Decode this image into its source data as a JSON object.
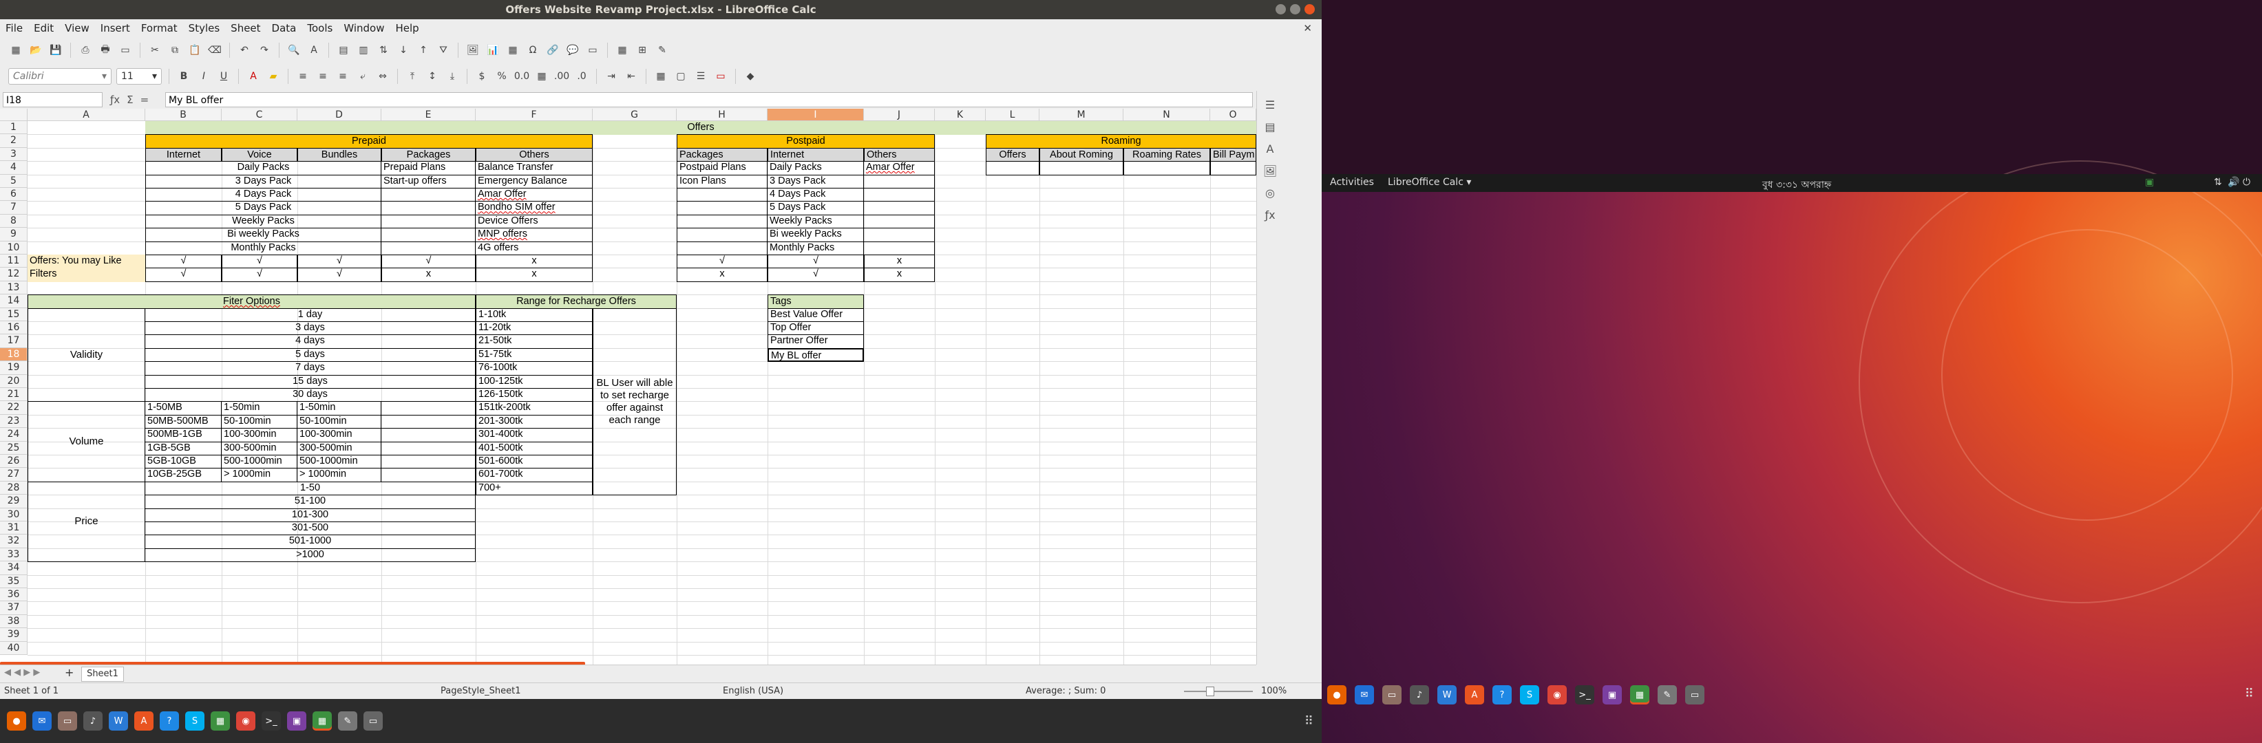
{
  "window": {
    "title": "Offers Website Revamp Project.xlsx - LibreOffice Calc"
  },
  "menu": [
    "File",
    "Edit",
    "View",
    "Insert",
    "Format",
    "Styles",
    "Sheet",
    "Data",
    "Tools",
    "Window",
    "Help"
  ],
  "font": {
    "name": "Calibri",
    "size": "11"
  },
  "formula": {
    "cell_ref": "I18",
    "content": "My BL  offer"
  },
  "columns": [
    "A",
    "B",
    "C",
    "D",
    "E",
    "F",
    "G",
    "H",
    "I",
    "J",
    "K",
    "L",
    "M",
    "N",
    "O"
  ],
  "rows": [
    "1",
    "2",
    "3",
    "4",
    "5",
    "6",
    "7",
    "8",
    "9",
    "10",
    "11",
    "12",
    "13",
    "14",
    "15",
    "16",
    "17",
    "18",
    "19",
    "20",
    "21",
    "22",
    "23",
    "24",
    "25",
    "26",
    "27",
    "28",
    "29",
    "30",
    "31",
    "32",
    "33",
    "34",
    "35",
    "36",
    "37",
    "38",
    "39",
    "40"
  ],
  "sheet": {
    "offers_title": "Offers",
    "prepaid": "Prepaid",
    "postpaid": "Postpaid",
    "roaming": "Roaming",
    "pre_headers": [
      "Internet",
      "Voice",
      "Bundles",
      "Packages",
      "Others"
    ],
    "post_headers": [
      "Packages",
      "Internet",
      "Others"
    ],
    "roam_headers": [
      "Offers",
      "About Roming",
      "Roaming Rates",
      "Bill Paym"
    ],
    "pre_packs": [
      "Daily Packs",
      "3 Days Pack",
      "4 Days Pack",
      "5 Days Pack",
      "Weekly Packs",
      "Bi weekly Packs",
      "Monthly Packs"
    ],
    "pre_packages": [
      "Prepaid Plans",
      "Start-up offers"
    ],
    "pre_others": [
      "Balance Transfer",
      "Emergency Balance",
      "Amar Offer",
      "Bondho SIM offer",
      "Device Offers",
      "MNP offers",
      "4G offers"
    ],
    "post_packages": [
      "Postpaid Plans",
      "Icon Plans"
    ],
    "post_internet": [
      "Daily Packs",
      "3 Days Pack",
      "4 Days Pack",
      "5 Days Pack",
      "Weekly Packs",
      "Bi weekly Packs",
      "Monthly Packs"
    ],
    "post_others": [
      "Amar Offer"
    ],
    "row11_label": "Offers: You may Like",
    "row12_label": "Filters",
    "row11_vals": [
      "√",
      "√",
      "√",
      "√",
      "x",
      "√",
      "√",
      "x"
    ],
    "row12_vals": [
      "√",
      "√",
      "√",
      "x",
      "x",
      "x",
      "√",
      "x"
    ],
    "filter_title": "Fiter Options",
    "validity_label": "Validity",
    "validity": [
      "1 day",
      "3 days",
      "4 days",
      "5 days",
      "7 days",
      "15 days",
      "30 days"
    ],
    "volume_label": "Volume",
    "volume_internet": [
      "1-50MB",
      "50MB-500MB",
      "500MB-1GB",
      "1GB-5GB",
      "5GB-10GB",
      "10GB-25GB"
    ],
    "volume_voice": [
      "1-50min",
      "50-100min",
      "100-300min",
      "300-500min",
      "500-1000min",
      "> 1000min"
    ],
    "volume_bundle": [
      "1-50min",
      "50-100min",
      "100-300min",
      "300-500min",
      "500-1000min",
      "> 1000min"
    ],
    "price_label": "Price",
    "price": [
      "1-50",
      "51-100",
      "101-300",
      "301-500",
      "501-1000",
      ">1000"
    ],
    "range_title": "Range for Recharge Offers",
    "ranges": [
      "1-10tk",
      "11-20tk",
      "21-50tk",
      "51-75tk",
      "76-100tk",
      "100-125tk",
      "126-150tk",
      "151tk-200tk",
      "201-300tk",
      "301-400tk",
      "401-500tk",
      "501-600tk",
      "601-700tk",
      "700+"
    ],
    "range_note": "BL User will able to set recharge offer against each range",
    "tags_title": "Tags",
    "tags": [
      "Best Value Offer",
      "Top Offer",
      "Partner Offer",
      "My BL  offer"
    ]
  },
  "tabs": {
    "sheet1": "Sheet1",
    "add": "+"
  },
  "status": {
    "sheet": "Sheet 1 of 1",
    "page_style": "PageStyle_Sheet1",
    "language": "English (USA)",
    "summary": "Average: ; Sum: 0",
    "zoom": "100%"
  },
  "desktop": {
    "activities": "Activities",
    "app_menu": "LibreOffice Calc ▾",
    "clock": "বুধ ৩:৩১ অপরাহ্ন"
  }
}
